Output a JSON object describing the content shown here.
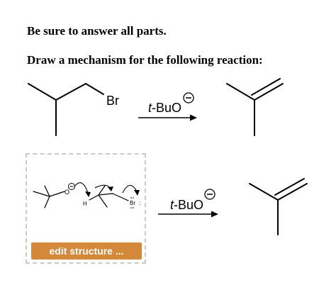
{
  "instructions": {
    "line1": "Be sure to answer all parts.",
    "line2": "Draw a mechanism for the following reaction:"
  },
  "reaction1": {
    "leaving_group": "Br",
    "reagent_prefix": "t",
    "reagent_rest": "-BuO",
    "charge": "−"
  },
  "mechanism": {
    "oxygen": "O",
    "charge": "−",
    "hydrogen": "H",
    "bromine": "Br",
    "bromine_lone_pair": ":",
    "edit_button_label": "edit structure ..."
  },
  "reaction2": {
    "reagent_prefix": "t",
    "reagent_rest": "-BuO",
    "charge": "−"
  },
  "colors": {
    "button": "#d4893a",
    "dashed_border": "#c9c9c9"
  }
}
